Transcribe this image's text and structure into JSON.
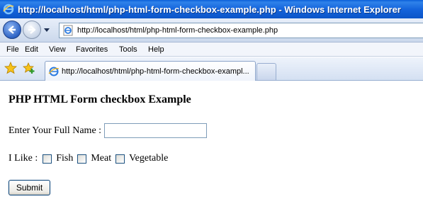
{
  "window": {
    "title": "http://localhost/html/php-html-form-checkbox-example.php - Windows Internet Explorer"
  },
  "address_bar": {
    "url": "http://localhost/html/php-html-form-checkbox-example.php"
  },
  "menu": {
    "items": [
      "File",
      "Edit",
      "View",
      "Favorites",
      "Tools",
      "Help"
    ]
  },
  "tabs": {
    "active_label": "http://localhost/html/php-html-form-checkbox-exampl..."
  },
  "page": {
    "heading": "PHP HTML Form checkbox Example",
    "name_label": "Enter Your Full Name :",
    "name_value": "",
    "like_label": "I Like :",
    "options": [
      {
        "label": "Fish",
        "checked": false
      },
      {
        "label": "Meat",
        "checked": false
      },
      {
        "label": "Vegetable",
        "checked": false
      }
    ],
    "submit_label": "Submit"
  },
  "colors": {
    "titlebar": "#1464dc",
    "accent": "#0b55c8"
  }
}
